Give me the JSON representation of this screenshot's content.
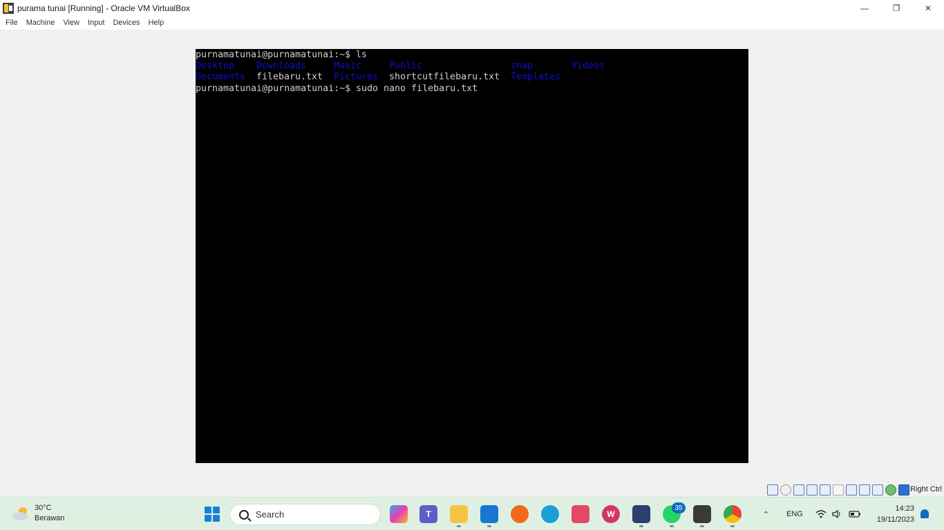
{
  "window": {
    "title": "purama tunai [Running] - Oracle VM VirtualBox",
    "controls": {
      "minimize": "—",
      "restore": "❐",
      "close": "✕"
    }
  },
  "menu": [
    "File",
    "Machine",
    "View",
    "Input",
    "Devices",
    "Help"
  ],
  "terminal": {
    "prompt": "purnamatunai@purnamatunai:~$",
    "command1": "ls",
    "row1": [
      "Desktop",
      "Downloads",
      "Music",
      "Public",
      "snap",
      "Videos"
    ],
    "row2": [
      "Documents",
      "filebaru.txt",
      "Pictures",
      "shortcutfilebaru.txt",
      "Templates"
    ],
    "command2": "sudo nano filebaru.txt",
    "colors": {
      "directory": "#1010c8",
      "text": "#d0d0d0",
      "background": "#000000"
    }
  },
  "vb_status": {
    "host_key": "Right Ctrl"
  },
  "taskbar": {
    "weather": {
      "temp": "30°C",
      "condition": "Berawan"
    },
    "search_label": "Search",
    "apps": [
      "copilot-icon",
      "teams-icon",
      "file-explorer-icon",
      "app-store-icon",
      "firefox-icon",
      "edge-icon",
      "snipping-tool-icon",
      "wps-icon",
      "virtualbox-icon",
      "whatsapp-icon",
      "virtualbox-vm-icon",
      "chrome-icon"
    ],
    "whatsapp_badge": "35",
    "language": "ENG",
    "time": "14:23",
    "date": "19/11/2023"
  }
}
